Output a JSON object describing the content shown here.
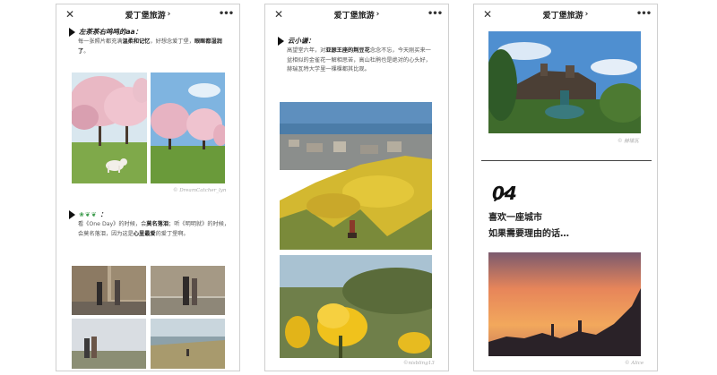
{
  "window": {
    "title": "爱丁堡旅游",
    "close": "✕",
    "more": "•••",
    "chevron": "›"
  },
  "panel1": {
    "section1": {
      "author": "左茶茶右鸣鸣的aa：",
      "text_a": "每一张照片都充满",
      "bold_a": "温柔和记忆",
      "text_b": "，好想念爱丁堡，",
      "bold_b": "眼眶都湿润了",
      "text_c": "。"
    },
    "credit1": "© DreamCatcher_lyn",
    "section2": {
      "author": "：",
      "text_a": "看《One Day》的时候，会",
      "bold_a": "莫名落泪",
      "text_b": "；听《明明就》的时候，会莫名落泪，因为这是",
      "bold_b": "心里最爱",
      "text_c": "的爱丁堡啊。"
    }
  },
  "panel2": {
    "section1": {
      "author": "云小谦：",
      "text_a": "高望堂六年，对",
      "bold_a": "亚瑟王座的荆豆花",
      "text_b": "念念不忘，今天刚买来一盆相似的金雀花一解相思苦，高山杜鹃也是绝对的心头好，赫瑞瓦特大学里一棵棵都其比观。"
    },
    "credit": "©nisbling13"
  },
  "panel3": {
    "credit1": "© 赫瑞瓦",
    "number": "04",
    "headline1": "喜欢一座城市",
    "headline2": "如果需要理由的话…",
    "credit2": "© Alice"
  },
  "colors": {
    "accent": "#222222",
    "muted": "#555555",
    "credit": "#aaaaaa"
  }
}
